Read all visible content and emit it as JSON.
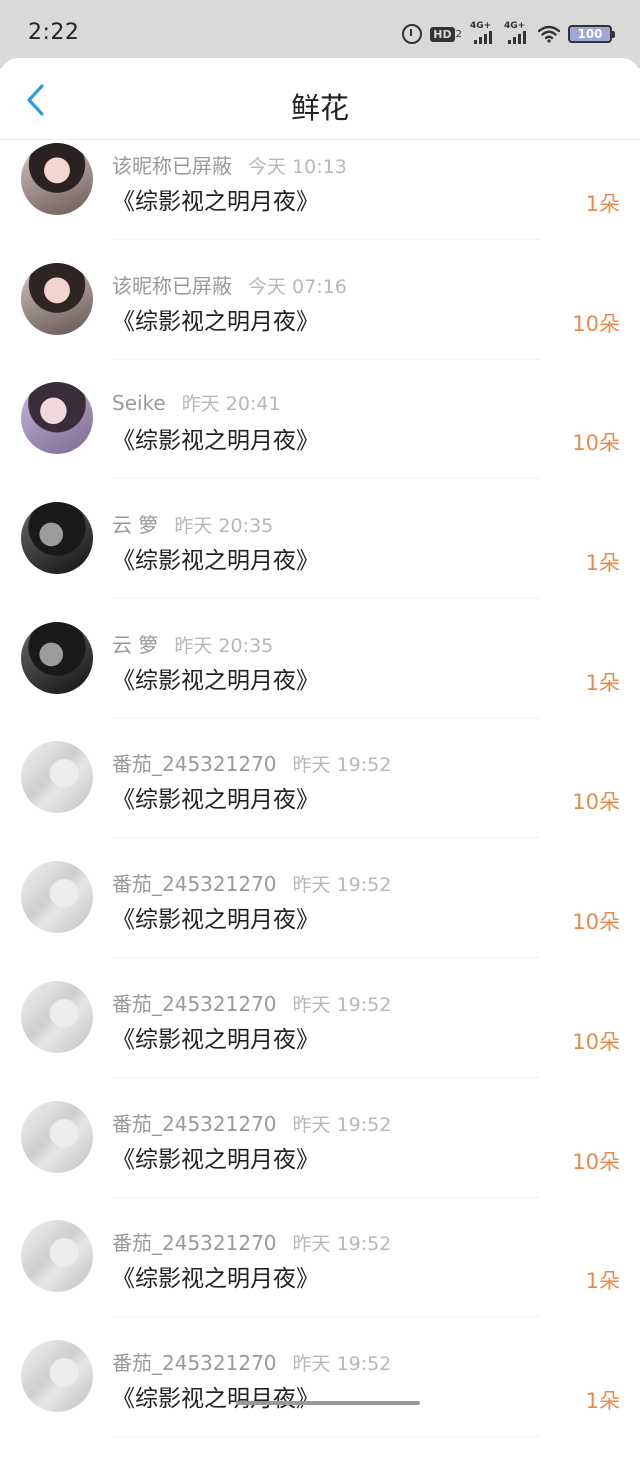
{
  "status_bar": {
    "time": "2:22",
    "hd_label": "HD",
    "hd_sub": "2",
    "signal1_label": "4G+",
    "signal2_label": "4G+",
    "battery": "100"
  },
  "header": {
    "title": "鲜花",
    "back_icon": "chevron-left-icon"
  },
  "colors": {
    "accent_blue": "#2d9cdb",
    "count_orange": "#ea8a4a"
  },
  "gifts": [
    {
      "name": "该昵称已屏蔽",
      "time": "今天 10:13",
      "book": "《综影视之明月夜》",
      "count": "1朵"
    },
    {
      "name": "该昵称已屏蔽",
      "time": "今天 07:16",
      "book": "《综影视之明月夜》",
      "count": "10朵"
    },
    {
      "name": "Seike",
      "time": "昨天 20:41",
      "book": "《综影视之明月夜》",
      "count": "10朵"
    },
    {
      "name": "云 箩",
      "time": "昨天 20:35",
      "book": "《综影视之明月夜》",
      "count": "1朵"
    },
    {
      "name": "云 箩",
      "time": "昨天 20:35",
      "book": "《综影视之明月夜》",
      "count": "1朵"
    },
    {
      "name": "番茄_245321270",
      "time": "昨天 19:52",
      "book": "《综影视之明月夜》",
      "count": "10朵"
    },
    {
      "name": "番茄_245321270",
      "time": "昨天 19:52",
      "book": "《综影视之明月夜》",
      "count": "10朵"
    },
    {
      "name": "番茄_245321270",
      "time": "昨天 19:52",
      "book": "《综影视之明月夜》",
      "count": "10朵"
    },
    {
      "name": "番茄_245321270",
      "time": "昨天 19:52",
      "book": "《综影视之明月夜》",
      "count": "10朵"
    },
    {
      "name": "番茄_245321270",
      "time": "昨天 19:52",
      "book": "《综影视之明月夜》",
      "count": "1朵"
    },
    {
      "name": "番茄_245321270",
      "time": "昨天 19:52",
      "book": "《综影视之明月夜》",
      "count": "1朵"
    }
  ]
}
